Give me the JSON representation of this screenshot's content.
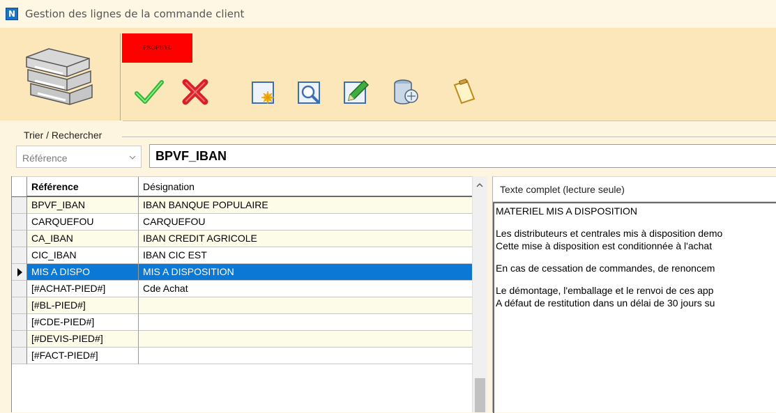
{
  "window": {
    "title": "Gestion des lignes de la commande client",
    "app_icon_letter": "N"
  },
  "toolbar": {
    "badge_label": "PROPHYL",
    "buttons": [
      {
        "icon": "validate-check-icon",
        "color": "#3bbf3b"
      },
      {
        "icon": "cancel-x-icon",
        "color": "#e0252e"
      },
      {
        "icon": "new-document-icon"
      },
      {
        "icon": "search-magnifier-icon"
      },
      {
        "icon": "edit-pencil-icon"
      },
      {
        "icon": "database-icon"
      },
      {
        "icon": "clipboard-icon"
      }
    ]
  },
  "sort_search": {
    "group_label": "Trier / Rechercher",
    "sort_field": "Référence",
    "search_value": "BPVF_IBAN"
  },
  "grid": {
    "columns": [
      "Référence",
      "Désignation"
    ],
    "rows": [
      {
        "ref": "BPVF_IBAN",
        "designation": "IBAN BANQUE POPULAIRE"
      },
      {
        "ref": "CARQUEFOU",
        "designation": "CARQUEFOU"
      },
      {
        "ref": "CA_IBAN",
        "designation": "IBAN CREDIT AGRICOLE"
      },
      {
        "ref": "CIC_IBAN",
        "designation": "IBAN CIC EST"
      },
      {
        "ref": "MIS A DISPO",
        "designation": "MIS A DISPOSITION"
      },
      {
        "ref": "[#ACHAT-PIED#]",
        "designation": "Cde Achat"
      },
      {
        "ref": "[#BL-PIED#]",
        "designation": ""
      },
      {
        "ref": "[#CDE-PIED#]",
        "designation": ""
      },
      {
        "ref": "[#DEVIS-PIED#]",
        "designation": ""
      },
      {
        "ref": "[#FACT-PIED#]",
        "designation": ""
      }
    ],
    "selected_index": 4,
    "selection_color": "#0a78d4"
  },
  "full_text": {
    "header": "Texte complet (lecture seule)",
    "lines": [
      "MATERIEL MIS A DISPOSITION",
      "",
      "Les distributeurs et centrales mis à disposition demo",
      "Cette mise à disposition est conditionnée à l'achat",
      "",
      "En cas de cessation de commandes, de renoncem",
      "",
      "Le démontage, l'emballage et le renvoi de ces app",
      "A défaut de restitution dans un délai de 30 jours su"
    ]
  }
}
